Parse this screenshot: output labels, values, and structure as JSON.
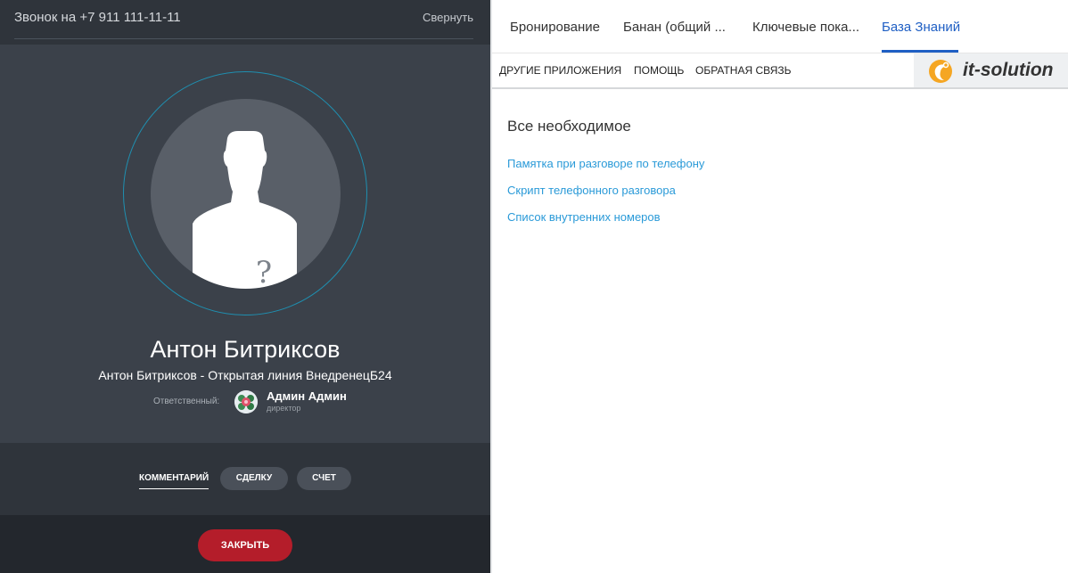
{
  "call": {
    "title": "Звонок на +7 911 111-11-11",
    "collapse_label": "Свернуть",
    "caller_name": "Антон Битриксов",
    "caller_subtitle": "Антон Битриксов - Открытая линия ВнедренецБ24",
    "responsible_label": "Ответственный:",
    "responsible_name": "Админ Админ",
    "responsible_role": "директор",
    "avatar_mark": "?",
    "actions": {
      "comment_label": "КОММЕНТАРИЙ",
      "deal_label": "СДЕЛКУ",
      "invoice_label": "СЧЕТ"
    },
    "close_label": "ЗАКРЫТЬ",
    "colors": {
      "panel_bg": "#3b414a",
      "ring": "#1f8fb0",
      "close_button": "#b41d2a"
    }
  },
  "right": {
    "tabs": [
      {
        "label": "Бронирование"
      },
      {
        "label": "Банан (общий ..."
      },
      {
        "label": "Ключевые пока..."
      },
      {
        "label": "База Знаний",
        "active": true
      }
    ],
    "subnav": [
      {
        "label": "ДРУГИЕ ПРИЛОЖЕНИЯ"
      },
      {
        "label": "ПОМОЩЬ"
      },
      {
        "label": "ОБРАТНАЯ СВЯЗЬ"
      }
    ],
    "logo_text": "it-solution",
    "heading": "Все необходимое",
    "links": [
      {
        "label": "Памятка при разговоре по телефону"
      },
      {
        "label": "Скрипт телефонного разговора"
      },
      {
        "label": "Список внутренних номеров"
      }
    ],
    "colors": {
      "active_tab": "#1f5fc4",
      "link": "#2a9ad8",
      "logo_accent": "#f5a623"
    }
  }
}
